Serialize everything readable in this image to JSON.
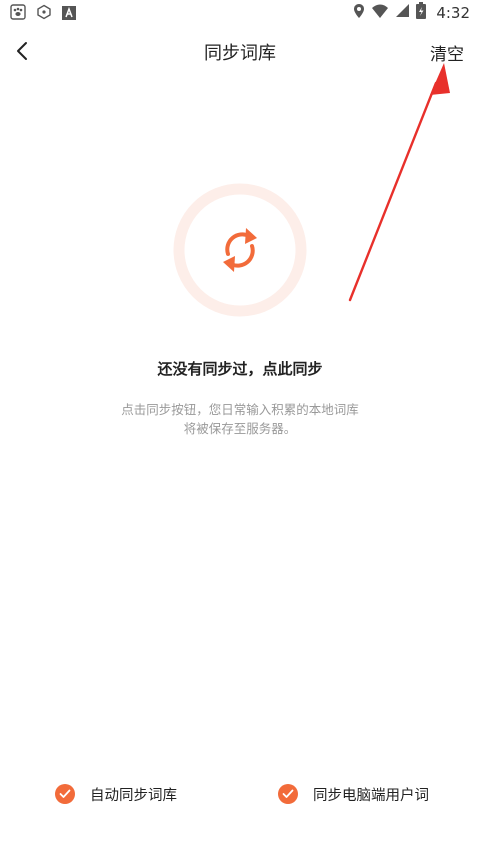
{
  "status_bar": {
    "time": "4:32",
    "icons": [
      "paw-icon",
      "hex-icon",
      "a-icon",
      "location-icon",
      "wifi-icon",
      "signal-icon",
      "battery-icon"
    ]
  },
  "header": {
    "title": "同步词库",
    "clear_label": "清空"
  },
  "empty_state": {
    "title": "还没有同步过，点此同步",
    "desc_line1": "点击同步按钮，您日常输入积累的本地词库",
    "desc_line2": "将被保存至服务器。"
  },
  "options": [
    {
      "label": "自动同步词库",
      "checked": true
    },
    {
      "label": "同步电脑端用户词",
      "checked": true
    }
  ],
  "colors": {
    "accent": "#f26b3a",
    "ring": "#fdeee9",
    "annotation": "#e8302b"
  }
}
